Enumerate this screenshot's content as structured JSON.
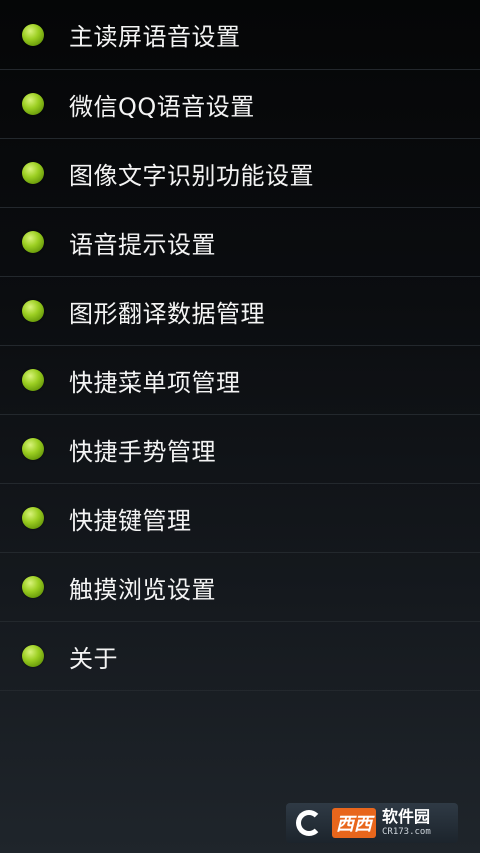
{
  "menu": {
    "items": [
      {
        "label": "主读屏语音设置"
      },
      {
        "label": "微信QQ语音设置"
      },
      {
        "label": "图像文字识别功能设置"
      },
      {
        "label": "语音提示设置"
      },
      {
        "label": "图形翻译数据管理"
      },
      {
        "label": "快捷菜单项管理"
      },
      {
        "label": "快捷手势管理"
      },
      {
        "label": "快捷键管理"
      },
      {
        "label": "触摸浏览设置"
      },
      {
        "label": "关于"
      }
    ],
    "bullet_icon": "green-dot-icon",
    "bullet_color": "#9ccf22"
  },
  "watermark": {
    "brand": "西西",
    "title": "软件园",
    "url": "CR173.com"
  },
  "colors": {
    "background_top": "#050607",
    "background_bottom": "#1f252b",
    "divider": "#23282d",
    "text": "#f4f4f4"
  }
}
